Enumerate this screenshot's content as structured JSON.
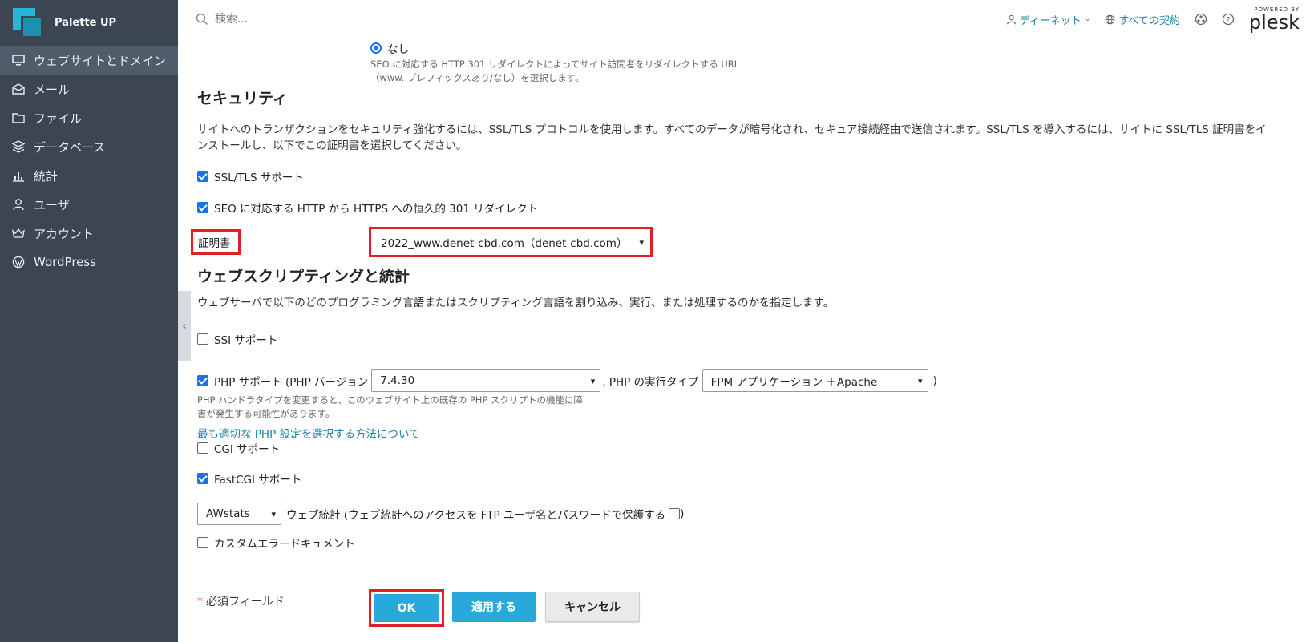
{
  "brand": {
    "name": "Palette UP"
  },
  "sidebar": {
    "items": [
      {
        "label": "ウェブサイトとドメイン",
        "icon": "monitor-icon",
        "active": true
      },
      {
        "label": "メール",
        "icon": "mail-icon"
      },
      {
        "label": "ファイル",
        "icon": "folder-icon"
      },
      {
        "label": "データベース",
        "icon": "database-icon"
      },
      {
        "label": "統計",
        "icon": "chart-icon"
      },
      {
        "label": "ユーザ",
        "icon": "user-icon"
      },
      {
        "label": "アカウント",
        "icon": "crown-icon"
      },
      {
        "label": "WordPress",
        "icon": "wordpress-icon"
      }
    ]
  },
  "header": {
    "search_placeholder": "検索...",
    "user_label": "ディーネット",
    "subscriptions_label": "すべての契約",
    "plesk_powered": "POWERED BY",
    "plesk_name": "plesk"
  },
  "seo_redirect": {
    "none_label": "なし",
    "hint_line1": "SEO に対応する HTTP 301 リダイレクトによってサイト訪問者をリダイレクトする URL",
    "hint_line2": "（www. プレフィックスあり/なし）を選択します。"
  },
  "security": {
    "title": "セキュリティ",
    "desc_line1": "サイトへのトランザクションをセキュリティ強化するには、SSL/TLS プロトコルを使用します。すべてのデータが暗号化され、セキュア接続経由で送信されます。SSL/TLS を導入するには、サイトに SSL/TLS 証明書をイ",
    "desc_line2": "ンストールし、以下でこの証明書を選択してください。",
    "ssl_support": "SSL/TLS サポート",
    "https_redirect": "SEO に対応する HTTP から HTTPS への恒久的 301 リダイレクト",
    "certificate_label": "証明書",
    "certificate_value": "2022_www.denet-cbd.com（denet-cbd.com）"
  },
  "scripting": {
    "title": "ウェブスクリプティングと統計",
    "desc": "ウェブサーバで以下のどのプログラミング言語またはスクリプティング言語を割り込み、実行、または処理するのかを指定します。",
    "ssi": "SSI サポート",
    "php_label": "PHP サポート (PHP バージョン",
    "php_version": "7.4.30",
    "php_handler_label": ", PHP の実行タイプ",
    "php_handler": "FPM アプリケーション ＋Apache",
    "php_close": ")",
    "php_hint_line1": "PHP ハンドラタイプを変更すると、このウェブサイト上の既存の PHP スクリプトの機能に障",
    "php_hint_line2": "書が発生する可能性があります。",
    "php_link": "最も適切な PHP 設定を選択する方法について",
    "cgi": "CGI サポート",
    "fastcgi": "FastCGI サポート",
    "stats_select": "AWstats",
    "stats_label": "ウェブ統計 (ウェブ統計へのアクセスを FTP ユーザ名とパスワードで保護する",
    "stats_close": ")",
    "custom_errors": "カスタムエラードキュメント"
  },
  "footer": {
    "required": "必須フィールド",
    "required_mark": "*",
    "ok": "OK",
    "apply": "適用する",
    "cancel": "キャンセル"
  },
  "colors": {
    "sidebar_bg": "#3b4652",
    "accent": "#29a8dc",
    "highlight": "#e01f26",
    "link": "#1f7fa6"
  }
}
